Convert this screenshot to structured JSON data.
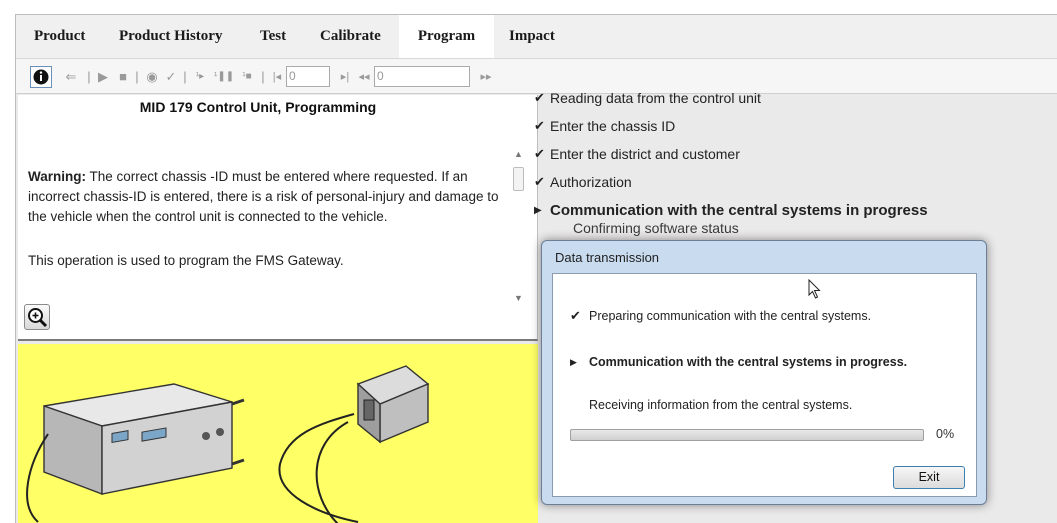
{
  "tabs": [
    "Product",
    "Product History",
    "Test",
    "Calibrate",
    "Program",
    "Impact"
  ],
  "active_tab": "Program",
  "toolbar": {
    "info_glyph": "i",
    "start_field_value": "0",
    "end_field_value": "0"
  },
  "left_panel": {
    "title": "MID 179 Control Unit, Programming",
    "warning_label": "Warning:",
    "warning_text": " The correct chassis -ID must be entered where requested. If an incorrect chassis-ID is entered, there is a risk of personal-injury and damage to the vehicle when the control unit is connected to the vehicle.",
    "info_text": "This operation is used to program the FMS Gateway."
  },
  "steps": [
    {
      "mark": "✔",
      "label": "Reading data from the control unit"
    },
    {
      "mark": "✔",
      "label": "Enter the chassis ID"
    },
    {
      "mark": "✔",
      "label": "Enter the district and customer"
    },
    {
      "mark": "✔",
      "label": "Authorization"
    },
    {
      "mark": "▶",
      "label": "Communication with the central systems in progress"
    }
  ],
  "step_status": "Confirming software status",
  "dialog": {
    "title": "Data transmission",
    "line1": {
      "mark": "✔",
      "text": "Preparing communication with the central systems."
    },
    "line2": {
      "mark": "▶",
      "text": "Communication with the central systems in progress."
    },
    "line3": "Receiving information from the central systems.",
    "progress_percent": 0,
    "progress_label": "0%",
    "exit_label": "Exit"
  },
  "colors": {
    "image_background": "#ffff66",
    "dialog_frame": "#c9dcef",
    "progress_fill": "#4fbf3a"
  }
}
